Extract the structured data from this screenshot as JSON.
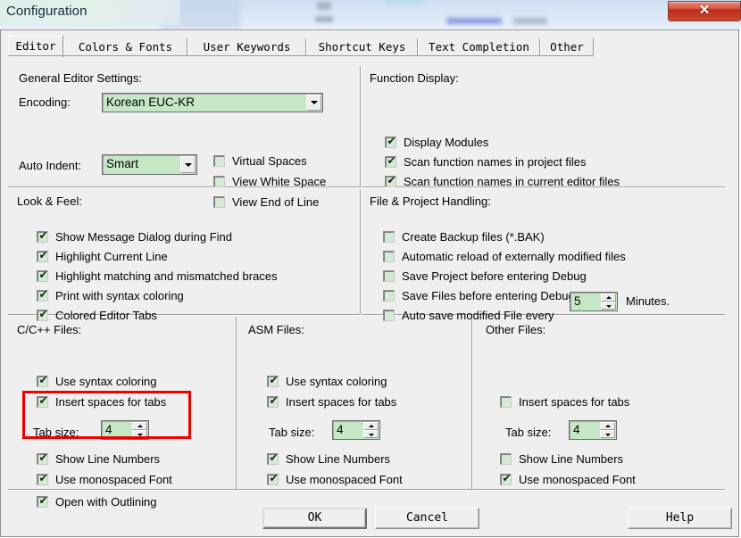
{
  "window": {
    "title": "Configuration",
    "close_label": "✕"
  },
  "tabs": [
    {
      "label": "Editor",
      "active": true
    },
    {
      "label": "Colors & Fonts",
      "active": false
    },
    {
      "label": "User Keywords",
      "active": false
    },
    {
      "label": "Shortcut Keys",
      "active": false
    },
    {
      "label": "Text Completion",
      "active": false
    },
    {
      "label": "Other",
      "active": false
    }
  ],
  "general_editor": {
    "title": "General Editor Settings:",
    "encoding_label": "Encoding:",
    "encoding_value": "Korean EUC-KR",
    "auto_indent_label": "Auto Indent:",
    "auto_indent_value": "Smart",
    "checks": [
      {
        "label": "Virtual Spaces",
        "checked": false
      },
      {
        "label": "View White Space",
        "checked": false
      },
      {
        "label": "View End of Line",
        "checked": false
      }
    ]
  },
  "function_display": {
    "title": "Function Display:",
    "checks": [
      {
        "label": "Display Modules",
        "checked": true
      },
      {
        "label": "Scan function names in project files",
        "checked": true
      },
      {
        "label": "Scan function names in current editor files",
        "checked": true
      }
    ]
  },
  "look_feel": {
    "title": "Look & Feel:",
    "checks": [
      {
        "label": "Show Message Dialog during Find",
        "checked": true
      },
      {
        "label": "Highlight Current Line",
        "checked": true
      },
      {
        "label": "Highlight matching and mismatched braces",
        "checked": true
      },
      {
        "label": "Print with syntax coloring",
        "checked": true
      },
      {
        "label": "Colored Editor Tabs",
        "checked": true
      }
    ]
  },
  "file_project": {
    "title": "File & Project Handling:",
    "checks": [
      {
        "label": "Create Backup files (*.BAK)",
        "checked": false
      },
      {
        "label": "Automatic reload of externally modified files",
        "checked": false
      },
      {
        "label": "Save Project before entering Debug",
        "checked": false
      },
      {
        "label": "Save Files before entering Debug",
        "checked": false
      },
      {
        "label": "Auto save modified File every",
        "checked": false
      }
    ],
    "autosave_value": "5",
    "autosave_unit": "Minutes."
  },
  "c_files": {
    "title": "C/C++ Files:",
    "checks": [
      {
        "label": "Use syntax coloring",
        "checked": true
      },
      {
        "label": "Insert spaces for tabs",
        "checked": true
      },
      {
        "label": "Show Line Numbers",
        "checked": true
      },
      {
        "label": "Use monospaced Font",
        "checked": true
      },
      {
        "label": "Open with Outlining",
        "checked": true
      }
    ],
    "tab_size_label": "Tab size:",
    "tab_size_value": "4"
  },
  "asm_files": {
    "title": "ASM Files:",
    "checks": [
      {
        "label": "Use syntax coloring",
        "checked": true
      },
      {
        "label": "Insert spaces for tabs",
        "checked": true
      },
      {
        "label": "Show Line Numbers",
        "checked": true
      },
      {
        "label": "Use monospaced Font",
        "checked": true
      }
    ],
    "tab_size_label": "Tab size:",
    "tab_size_value": "4"
  },
  "other_files": {
    "title": "Other Files:",
    "checks": [
      {
        "label": "Insert spaces for tabs",
        "checked": false
      },
      {
        "label": "Show Line Numbers",
        "checked": false
      },
      {
        "label": "Use monospaced Font",
        "checked": true
      }
    ],
    "tab_size_label": "Tab size:",
    "tab_size_value": "4"
  },
  "footer": {
    "ok": "OK",
    "cancel": "Cancel",
    "help": "Help"
  },
  "annotation": {
    "color": "#ee0000"
  },
  "icons": {
    "check": "✔",
    "dropdown": "chevron-down-icon"
  }
}
